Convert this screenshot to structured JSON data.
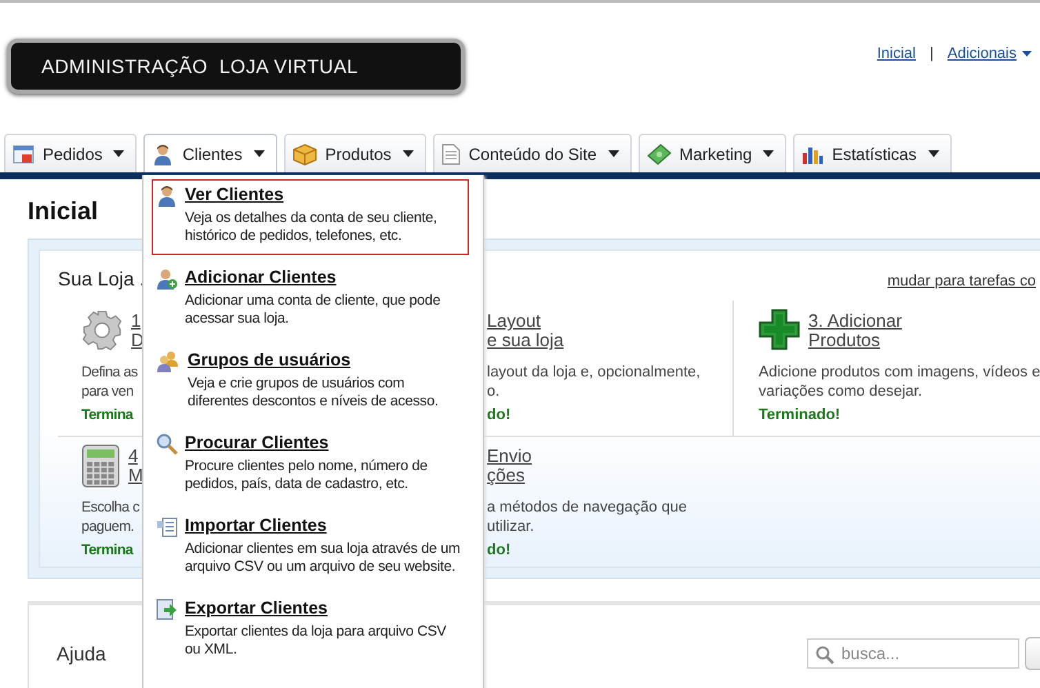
{
  "header": {
    "logo_text": "ADMINISTRAÇÃO  LOJA VIRTUAL",
    "top_links": [
      {
        "kind": "link",
        "label": "Inicial"
      },
      {
        "kind": "separator",
        "label": "|"
      },
      {
        "kind": "menu",
        "label": "Adicionais"
      }
    ]
  },
  "nav": {
    "tabs": [
      {
        "label": "Pedidos",
        "selected": false
      },
      {
        "label": "Clientes",
        "selected": true
      },
      {
        "label": "Produtos",
        "selected": false
      },
      {
        "label": "Conteúdo do Site",
        "selected": false
      },
      {
        "label": "Marketing",
        "selected": false
      },
      {
        "label": "Estatísticas",
        "selected": false
      }
    ]
  },
  "dropdown": {
    "items": [
      {
        "title": "Ver Clientes",
        "description": "Veja os detalhes da conta de seu cliente, histórico de pedidos, telefones, etc.",
        "selected": true
      },
      {
        "title": "Adicionar Clientes",
        "description": "Adicionar uma conta de cliente, que pode acessar sua loja.",
        "selected": false
      },
      {
        "title": "Grupos de usuários",
        "description": "Veja e crie grupos de usuários com diferentes descontos e níveis de acesso.",
        "selected": false
      },
      {
        "title": "Procurar Clientes",
        "description": "Procure clientes pelo nome, número de pedidos, país, data de cadastro, etc.",
        "selected": false
      },
      {
        "title": "Importar Clientes",
        "description": "Adicionar clientes em sua loja através de um arquivo CSV ou um arquivo de seu website.",
        "selected": false
      },
      {
        "title": "Exportar Clientes",
        "description": "Exportar clientes da loja para arquivo CSV ou XML.",
        "selected": false
      }
    ]
  },
  "page_title": "Inicial",
  "setup_card": {
    "title": "Sua Loja .",
    "switch_link": "mudar para tarefas co",
    "tasks": [
      {
        "title_lines": [
          "1",
          "D"
        ],
        "description_lines": [
          "Defina as",
          "para ven"
        ],
        "status": "Termina"
      },
      {
        "title_lines": [
          "Layout",
          "e sua loja"
        ],
        "description_lines": [
          "layout da loja e, opcionalmente,",
          "o."
        ],
        "status": "do!"
      },
      {
        "title_lines": [
          "3. Adicionar",
          "Produtos"
        ],
        "description_lines": [
          "Adicione produtos com imagens, vídeos e",
          "variações como desejar."
        ],
        "status": "Terminado!"
      },
      {
        "title_lines": [
          "4",
          "M"
        ],
        "description_lines": [
          "Escolha c",
          "paguem."
        ],
        "status": "Termina"
      },
      {
        "title_lines": [
          "Envio",
          "ções"
        ],
        "description_lines": [
          "a métodos de navegação que",
          "utilizar."
        ],
        "status": "do!"
      }
    ]
  },
  "help_card": {
    "title": "Ajuda",
    "search": {
      "placeholder": "busca..."
    }
  }
}
